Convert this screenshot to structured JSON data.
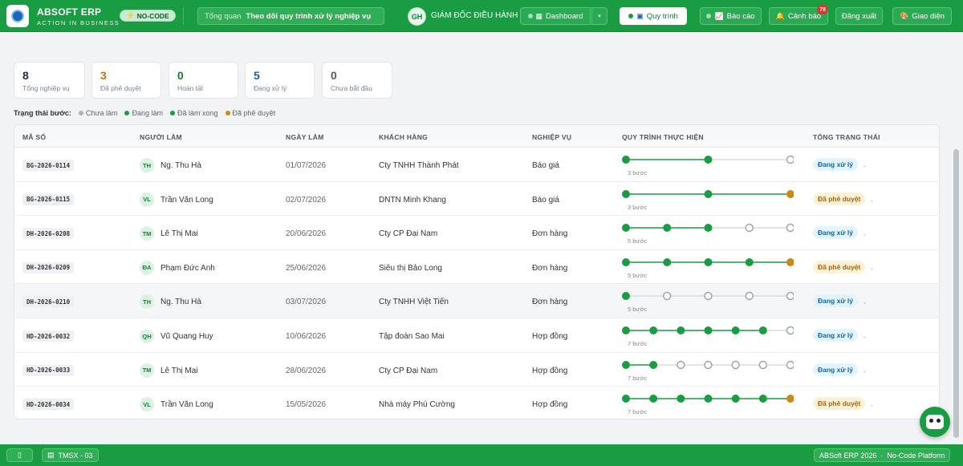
{
  "brand": {
    "name": "ABSOFT ERP",
    "tagline": "ACTION IN BUSINESS",
    "badge": "NO-CODE"
  },
  "breadcrumb": {
    "root": "Tổng quan",
    "current": "Theo dõi quy trình xử lý nghiệp vụ"
  },
  "user": {
    "initials": "GH",
    "role": "GIÁM ĐỐC ĐIỀU HÀNH"
  },
  "nav": {
    "dashboard": "Dashboard",
    "process": "Quy trình",
    "report": "Báo cáo",
    "alert": "Cảnh báo",
    "alert_count": "78",
    "logout": "Đăng xuất",
    "theme": "Giao diện"
  },
  "stats": [
    {
      "value": "8",
      "label": "Tổng nghiệp vụ",
      "color": "#1f2d3d"
    },
    {
      "value": "3",
      "label": "Đã phê duyệt",
      "color": "#b9770e"
    },
    {
      "value": "0",
      "label": "Hoàn tất",
      "color": "#1a7a3a"
    },
    {
      "value": "5",
      "label": "Đang xử lý",
      "color": "#1a5fa8"
    },
    {
      "value": "0",
      "label": "Chưa bắt đầu",
      "color": "#555c66"
    }
  ],
  "legend": {
    "title": "Trạng thái bước:",
    "items": [
      {
        "label": "Chưa làm",
        "color": "#aab2bc"
      },
      {
        "label": "Đang làm",
        "color": "#1a9c43"
      },
      {
        "label": "Đã làm xong",
        "color": "#1a9c43"
      },
      {
        "label": "Đã phê duyệt",
        "color": "#c98a1a"
      }
    ]
  },
  "table": {
    "headers": [
      "MÃ SỐ",
      "NGƯỜI LÀM",
      "NGÀY LÀM",
      "KHÁCH HÀNG",
      "NGHIỆP VỤ",
      "QUY TRÌNH THỰC HIỆN",
      "TỔNG TRẠNG THÁI"
    ],
    "rows": [
      {
        "code": "BG-2026-0114",
        "initials": "TH",
        "person": "Ng. Thu Hà",
        "date": "01/07/2026",
        "customer": "Cty TNHH Thành Phát",
        "type": "Báo giá",
        "steps_label": "3 bước",
        "steps": [
          "done",
          "done",
          "todo"
        ],
        "status": "Đang xử lý",
        "status_kind": "p"
      },
      {
        "code": "BG-2026-0115",
        "initials": "VL",
        "person": "Trần Văn Long",
        "date": "02/07/2026",
        "customer": "DNTN Minh Khang",
        "type": "Báo giá",
        "steps_label": "3 bước",
        "steps": [
          "done",
          "done",
          "appr"
        ],
        "status": "Đã phê duyệt",
        "status_kind": "a"
      },
      {
        "code": "DH-2026-0208",
        "initials": "TM",
        "person": "Lê Thị Mai",
        "date": "20/06/2026",
        "customer": "Cty CP Đại Nam",
        "type": "Đơn hàng",
        "steps_label": "5 bước",
        "steps": [
          "done",
          "done",
          "done",
          "todo",
          "todo"
        ],
        "status": "Đang xử lý",
        "status_kind": "p"
      },
      {
        "code": "DH-2026-0209",
        "initials": "ĐA",
        "person": "Phạm Đức Anh",
        "date": "25/06/2026",
        "customer": "Siêu thị Bảo Long",
        "type": "Đơn hàng",
        "steps_label": "5 bước",
        "steps": [
          "done",
          "done",
          "done",
          "done",
          "appr"
        ],
        "status": "Đã phê duyệt",
        "status_kind": "a"
      },
      {
        "code": "DH-2026-0210",
        "initials": "TH",
        "person": "Ng. Thu Hà",
        "date": "03/07/2026",
        "customer": "Cty TNHH Việt Tiến",
        "type": "Đơn hàng",
        "steps_label": "5 bước",
        "steps": [
          "done",
          "todo",
          "todo",
          "todo",
          "todo"
        ],
        "status": "Đang xử lý",
        "status_kind": "p"
      },
      {
        "code": "HD-2026-0032",
        "initials": "QH",
        "person": "Vũ Quang Huy",
        "date": "10/06/2026",
        "customer": "Tập đoàn Sao Mai",
        "type": "Hợp đồng",
        "steps_label": "7 bước",
        "steps": [
          "done",
          "done",
          "done",
          "done",
          "done",
          "done",
          "todo"
        ],
        "status": "Đang xử lý",
        "status_kind": "p"
      },
      {
        "code": "HD-2026-0033",
        "initials": "TM",
        "person": "Lê Thị Mai",
        "date": "28/06/2026",
        "customer": "Cty CP Đại Nam",
        "type": "Hợp đồng",
        "steps_label": "7 bước",
        "steps": [
          "done",
          "done",
          "todo",
          "todo",
          "todo",
          "todo",
          "todo"
        ],
        "status": "Đang xử lý",
        "status_kind": "p"
      },
      {
        "code": "HD-2026-0034",
        "initials": "VL",
        "person": "Trần Văn Long",
        "date": "15/05/2026",
        "customer": "Nhà máy Phú Cường",
        "type": "Hợp đồng",
        "steps_label": "7 bước",
        "steps": [
          "done",
          "done",
          "done",
          "done",
          "done",
          "done",
          "appr"
        ],
        "status": "Đã phê duyệt",
        "status_kind": "a"
      }
    ]
  },
  "footer": {
    "module": "TMSX - 03",
    "product": "ABSoft ERP 2026",
    "separator": "·",
    "platform": "No-Code Platform"
  }
}
